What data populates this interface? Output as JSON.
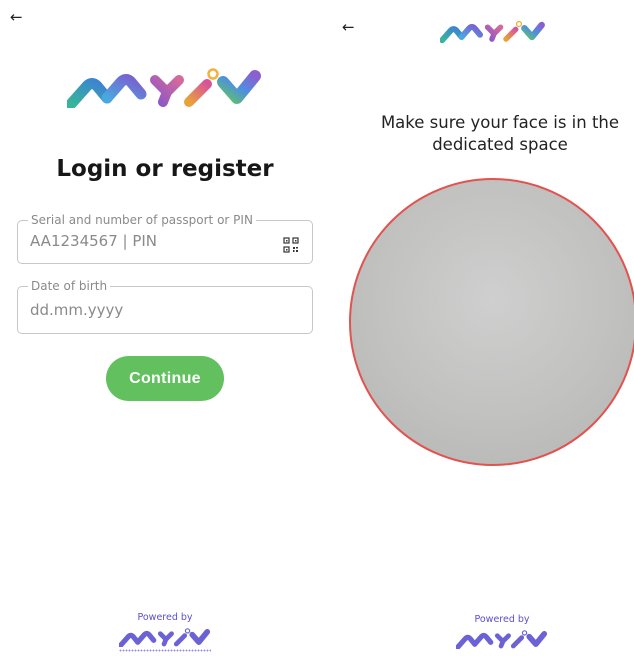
{
  "login_screen": {
    "back_icon": "arrow-left-icon",
    "title": "Login or register",
    "document_field": {
      "legend": "Serial and number of passport or PIN",
      "placeholder": "AA1234567 | PIN",
      "icon": "qr-code-icon"
    },
    "birth_field": {
      "legend": "Date of birth",
      "placeholder": "dd.mm.yyyy"
    },
    "continue_label": "Continue",
    "powered_by": "Powered by"
  },
  "face_screen": {
    "back_icon": "arrow-left-icon",
    "instruction": "Make sure your face is in the dedicated space",
    "powered_by": "Powered by"
  },
  "colors": {
    "accent_green": "#63c05f",
    "face_frame_red": "#e2524f",
    "powered_purple": "#5a4fd0",
    "logo_colors": [
      "#3fb39a",
      "#3a7bd5",
      "#8a56c9",
      "#d36b9c",
      "#f0b43c",
      "#5fc16c"
    ]
  }
}
